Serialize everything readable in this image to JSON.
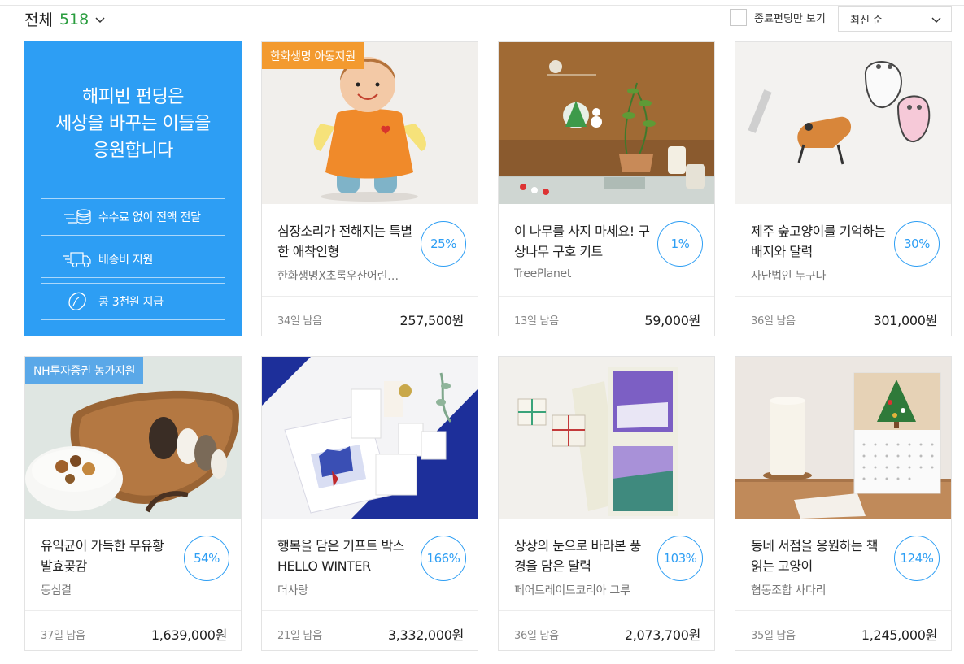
{
  "header": {
    "count_label": "전체",
    "count_value": "518",
    "filter_label": "종료펀딩만 보기",
    "sort_label": "최신 순"
  },
  "promo": {
    "line1": "해피빈 펀딩은",
    "line2": "세상을 바꾸는 이들을",
    "line3": "응원합니다",
    "buttons": [
      {
        "label": "수수료 없이 전액 전달",
        "icon": "coins-icon"
      },
      {
        "label": "배송비 지원",
        "icon": "truck-icon"
      },
      {
        "label": "콩 3천원 지급",
        "icon": "bean-icon"
      }
    ],
    "color": "#2d9ef4"
  },
  "cards": [
    {
      "badge": "한화생명 아동지원",
      "badge_color": "#f39a2f",
      "title": "심장소리가 전해지는 특별한 애착인형",
      "org": "한화생명X초록우산어린…",
      "rate": "25%",
      "days": "34일 남음",
      "amount": "257,500원"
    },
    {
      "badge": "",
      "title": "이 나무를 사지 마세요! 구상나무 구호 키트",
      "org": "TreePlanet",
      "rate": "1%",
      "days": "13일 남음",
      "amount": "59,000원"
    },
    {
      "badge": "",
      "title": "제주 숲고양이를 기억하는 배지와 달력",
      "org": "사단법인 누구나",
      "rate": "30%",
      "days": "36일 남음",
      "amount": "301,000원"
    },
    {
      "badge": "NH투자증권 농가지원",
      "badge_color": "#5aa8e8",
      "title": "유익균이 가득한 무유황 발효곶감",
      "org": "동심결",
      "rate": "54%",
      "days": "37일 남음",
      "amount": "1,639,000원"
    },
    {
      "badge": "",
      "title": "행복을 담은 기프트 박스 HELLO WINTER",
      "org": "더사랑",
      "rate": "166%",
      "days": "21일 남음",
      "amount": "3,332,000원"
    },
    {
      "badge": "",
      "title": "상상의 눈으로 바라본 풍경을 담은 달력",
      "org": "페어트레이드코리아 그루",
      "rate": "103%",
      "days": "36일 남음",
      "amount": "2,073,700원"
    },
    {
      "badge": "",
      "title": "동네 서점을 응원하는 책 읽는 고양이",
      "org": "협동조합 사다리",
      "rate": "124%",
      "days": "35일 남음",
      "amount": "1,245,000원"
    }
  ],
  "colors": {
    "accent": "#2d9ef4",
    "count": "#2a9d3f"
  }
}
